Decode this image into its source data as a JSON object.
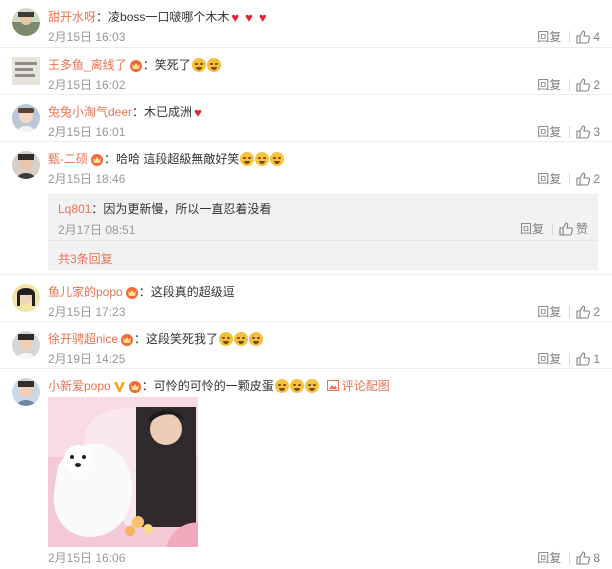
{
  "actions": {
    "reply": "回复",
    "like_label": "赞"
  },
  "comments": [
    {
      "user": "甜开水呀",
      "text": "凌boss一口啵哪个木木",
      "hearts": 3,
      "time": "2月15日 16:03",
      "likes": "4"
    },
    {
      "user": "王多鱼_离线了",
      "text": "笑死了",
      "time": "2月15日 16:02",
      "likes": "2"
    },
    {
      "user": "兔兔小淘气deer",
      "text": "木已成洲",
      "time": "2月15日 16:01",
      "likes": "3"
    },
    {
      "user": "甄-二硕",
      "text": "哈哈 這段超級無敵好笑",
      "time": "2月15日 18:46",
      "likes": "2",
      "reply": {
        "user": "Lq801",
        "text": "因为更新慢，所以一直忍着没看",
        "time": "2月17日 08:51"
      },
      "more_replies": "共3条回复"
    },
    {
      "user": "鱼儿家的popo",
      "text": "这段真的超级逗",
      "time": "2月15日 17:23",
      "likes": "2"
    },
    {
      "user": "徐开骋超nice",
      "text": "这段笑死我了",
      "time": "2月19日 14:25",
      "likes": "1"
    },
    {
      "user": "小新爱popo",
      "text": "可怜的可怜的一颗皮蛋",
      "pic_label": "评论配图",
      "time": "2月15日 16:06",
      "likes": "8"
    }
  ],
  "colors": {
    "username": "#eb7350",
    "meta": "#999999",
    "subbox_bg": "#f2f2f5",
    "heart": "#e0242e"
  }
}
